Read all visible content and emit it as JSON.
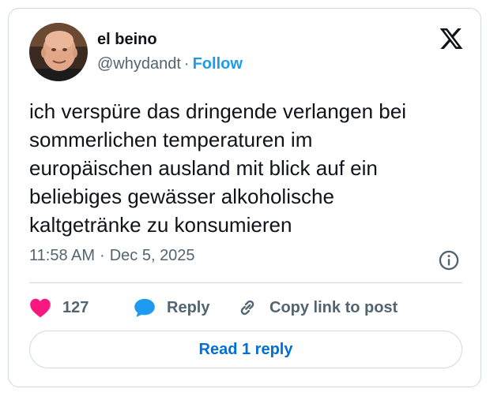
{
  "author": {
    "display_name": "el beino",
    "handle": "@whydandt",
    "separator": "·",
    "follow_label": "Follow"
  },
  "tweet": {
    "text": "ich verspüre das dringende verlangen bei\nsommerlichen temperaturen im\neuropäischen ausland mit blick auf ein\nbeliebiges gewässer alkoholische\nkaltgetränke zu konsumieren",
    "time": "11:58 AM",
    "separator": "·",
    "date": "Dec 5, 2025"
  },
  "actions": {
    "like_count": "127",
    "reply_label": "Reply",
    "copy_link_label": "Copy link to post"
  },
  "read_replies_label": "Read 1 reply",
  "icons": {
    "logo": "x-logo-icon",
    "info": "info-icon",
    "like": "heart-icon",
    "reply": "speech-bubble-icon",
    "copy": "link-icon"
  },
  "colors": {
    "accent": "#1d9bf0",
    "like": "#f91880",
    "text_secondary": "#536471",
    "link_button": "#006fd6",
    "border": "#cfd9de"
  }
}
